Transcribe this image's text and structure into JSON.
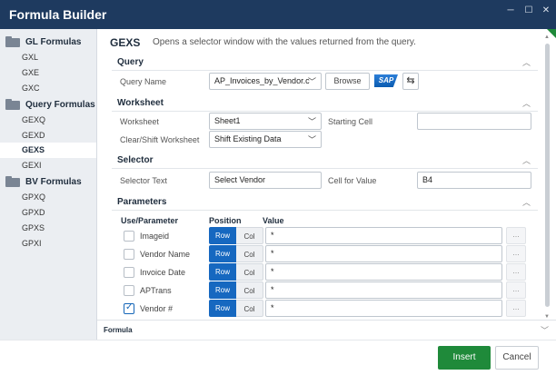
{
  "window": {
    "title": "Formula Builder",
    "controls": {
      "minimize": "─",
      "maximize": "☐",
      "close": "✕"
    }
  },
  "sidebar": {
    "groups": [
      {
        "label": "GL Formulas",
        "items": [
          "GXL",
          "GXE",
          "GXC"
        ]
      },
      {
        "label": "Query Formulas",
        "items": [
          "GEXQ",
          "GEXD",
          "GEXS",
          "GEXI"
        ]
      },
      {
        "label": "BV Formulas",
        "items": [
          "GPXQ",
          "GPXD",
          "GPXS",
          "GPXI"
        ]
      }
    ],
    "active_item": "GEXS"
  },
  "header": {
    "code": "GEXS",
    "description": "Opens a selector window with the values returned from the query."
  },
  "query": {
    "title": "Query",
    "query_name_label": "Query Name",
    "query_name_value": "AP_Invoices_by_Vendor.c",
    "browse_label": "Browse",
    "sap_logo": "SAP",
    "swap_icon": "⇆"
  },
  "worksheet": {
    "title": "Worksheet",
    "worksheet_label": "Worksheet",
    "worksheet_value": "Sheet1",
    "starting_cell_label": "Starting Cell",
    "starting_cell_value": "",
    "clear_shift_label": "Clear/Shift Worksheet",
    "clear_shift_value": "Shift Existing Data"
  },
  "selector": {
    "title": "Selector",
    "selector_text_label": "Selector Text",
    "selector_text_value": "Select Vendor",
    "cell_for_value_label": "Cell for Value",
    "cell_for_value_value": "B4"
  },
  "parameters": {
    "title": "Parameters",
    "col_use": "Use/Parameter",
    "col_position": "Position",
    "col_value": "Value",
    "row_label": "Row",
    "col_label": "Col",
    "more_label": "...",
    "rows": [
      {
        "name": "Imageid",
        "checked": false,
        "value": "*"
      },
      {
        "name": "Vendor Name",
        "checked": false,
        "value": "*"
      },
      {
        "name": "Invoice Date",
        "checked": false,
        "value": "*"
      },
      {
        "name": "APTrans",
        "checked": false,
        "value": "*"
      },
      {
        "name": "Vendor #",
        "checked": true,
        "value": "*"
      }
    ]
  },
  "formula": {
    "title": "Formula"
  },
  "footer": {
    "insert_label": "Insert",
    "cancel_label": "Cancel"
  },
  "colors": {
    "titlebar": "#1e3a5f",
    "accent_blue": "#1668c0",
    "insert_green": "#1f8a3a"
  }
}
